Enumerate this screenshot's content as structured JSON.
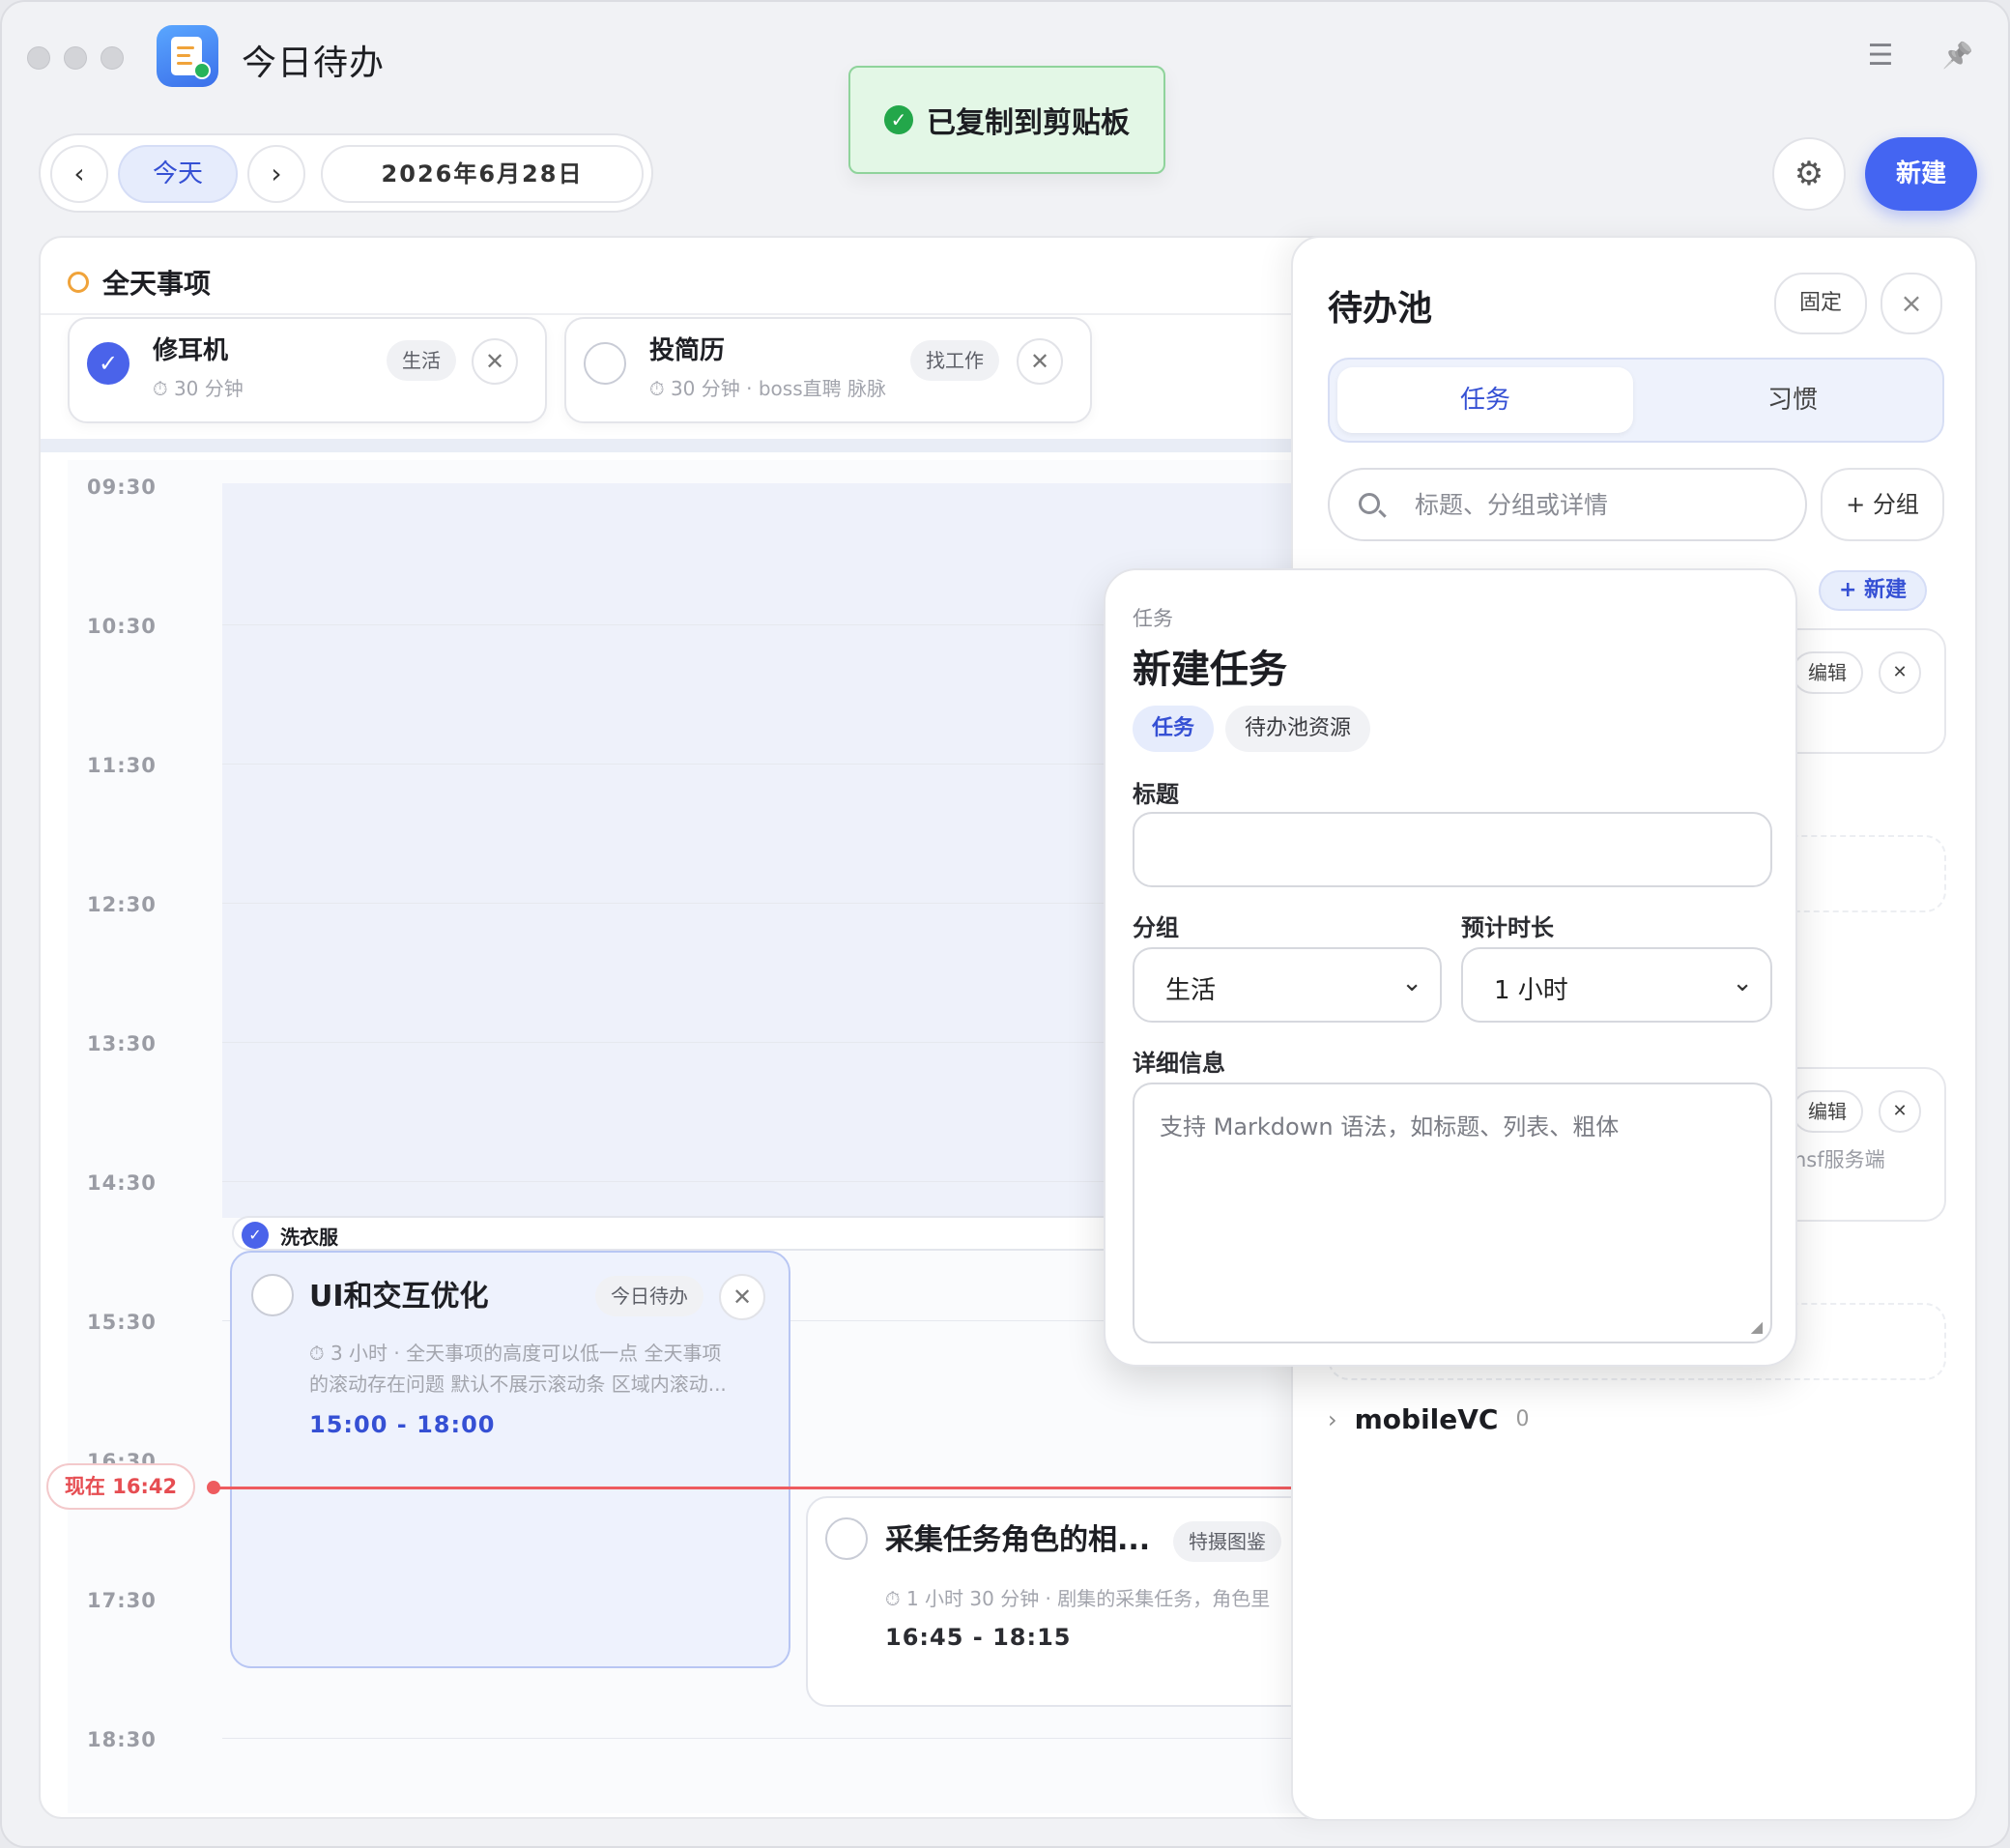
{
  "window": {
    "title": "今日待办",
    "menu_icon": "☰",
    "pin_icon": "📌"
  },
  "toast": {
    "text": "已复制到剪贴板",
    "icon": "✓"
  },
  "nav": {
    "prev": "‹",
    "today": "今天",
    "next": "›",
    "date": "2026年6月28日",
    "settings_icon": "⚙",
    "new_label": "新建"
  },
  "allday": {
    "title": "全天事项",
    "items": [
      {
        "title": "修耳机",
        "meta": "⏱ 30 分钟",
        "tag": "生活",
        "done": true
      },
      {
        "title": "投简历",
        "meta": "⏱ 30 分钟 · boss直聘 脉脉",
        "tag": "找工作",
        "done": false
      }
    ]
  },
  "timeline": {
    "hours": [
      "09:30",
      "10:30",
      "11:30",
      "12:30",
      "13:30",
      "14:30",
      "15:30",
      "16:30",
      "17:30",
      "18:30"
    ],
    "now_label": "现在 16:42",
    "events": [
      {
        "title": "洗衣服",
        "done": true
      },
      {
        "title": "UI和交互优化",
        "tag": "今日待办",
        "meta_line1": "⏱ 3 小时 · 全天事项的高度可以低一点 全天事项",
        "meta_line2": "的滚动存在问题 默认不展示滚动条 区域内滚动...",
        "time": "15:00 - 18:00"
      },
      {
        "title": "采集任务角色的相...",
        "tag": "特摄图鉴",
        "meta": "⏱ 1 小时 30 分钟 · 剧集的采集任务，角色里",
        "time": "16:45 - 18:15"
      }
    ]
  },
  "pool": {
    "title": "待办池",
    "pin_label": "固定",
    "close": "×",
    "tabs": [
      "任务",
      "习惯"
    ],
    "search_placeholder": "标题、分组或详情",
    "add_group": "+ 分组",
    "group_new": "+ 新建",
    "edit_label": "编辑",
    "collapsed_group": {
      "name": "mobileVC",
      "count": "0"
    },
    "partial_text": "hsf服务端"
  },
  "modal": {
    "eyebrow": "任务",
    "title": "新建任务",
    "tabs": [
      "任务",
      "待办池资源"
    ],
    "title_label": "标题",
    "title_value": "",
    "group_label": "分组",
    "group_value": "生活",
    "duration_label": "预计时长",
    "duration_value": "1 小时",
    "detail_label": "详细信息",
    "detail_placeholder": "支持 Markdown 语法，如标题、列表、粗体"
  }
}
